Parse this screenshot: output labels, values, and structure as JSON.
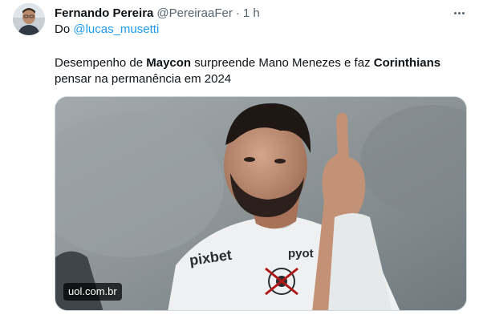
{
  "author": {
    "name": "Fernando Pereira",
    "handle": "@PereiraaFer",
    "separator": "·",
    "time": "1 h"
  },
  "reply": {
    "prefix": "Do ",
    "mention": "@lucas_musetti"
  },
  "tweet": {
    "t1": "Desempenho de ",
    "t2": "Maycon",
    "t3": " surpreende Mano Menezes e faz ",
    "t4": "Corinthians",
    "t5": "pensar na permanência em 2024"
  },
  "card": {
    "source": "uol.com.br",
    "shirt_sponsor_left": "pixbet",
    "shirt_sponsor_right": "pyot"
  },
  "icons": {
    "more": "more-horizontal-icon"
  },
  "colors": {
    "link": "#1d9bf0",
    "secondary_text": "#536471",
    "primary_text": "#0f1419"
  }
}
